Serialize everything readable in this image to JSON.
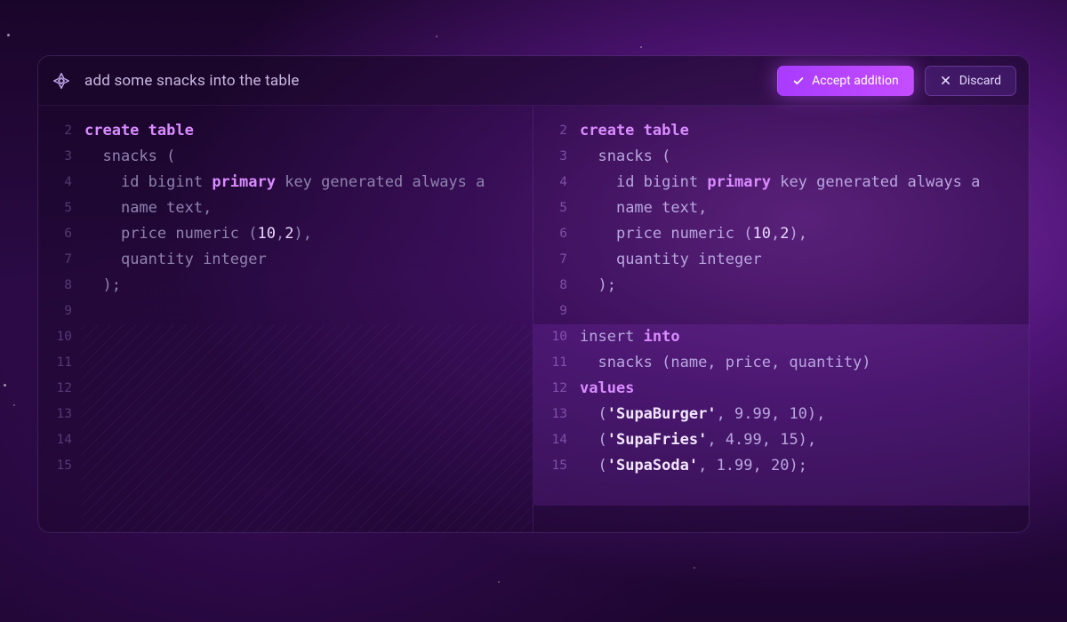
{
  "prompt": {
    "text": "add some snacks into the table",
    "accept_label": "Accept addition",
    "discard_label": "Discard"
  },
  "editor": {
    "line_numbers": [
      2,
      3,
      4,
      5,
      6,
      7,
      8,
      9,
      10,
      11,
      12,
      13,
      14,
      15
    ],
    "left": {
      "lines": [
        [
          [
            "kw",
            "create"
          ],
          [
            "sp",
            " "
          ],
          [
            "kw",
            "table"
          ]
        ],
        [
          [
            "ind",
            1
          ],
          [
            "base",
            "snacks ("
          ]
        ],
        [
          [
            "ind",
            2
          ],
          [
            "base",
            "id bigint "
          ],
          [
            "kw",
            "primary"
          ],
          [
            "base",
            " key generated always a"
          ]
        ],
        [
          [
            "ind",
            2
          ],
          [
            "base",
            "name text,"
          ]
        ],
        [
          [
            "ind",
            2
          ],
          [
            "base",
            "price numeric ("
          ],
          [
            "num",
            "10"
          ],
          [
            "base",
            ","
          ],
          [
            "num",
            "2"
          ],
          [
            "base",
            "),"
          ]
        ],
        [
          [
            "ind",
            2
          ],
          [
            "base",
            "quantity integer"
          ]
        ],
        [
          [
            "ind",
            1
          ],
          [
            "base",
            ");"
          ]
        ],
        [],
        [],
        [],
        [],
        [],
        [],
        []
      ]
    },
    "right": {
      "lines": [
        [
          [
            "kw",
            "create"
          ],
          [
            "sp",
            " "
          ],
          [
            "kw",
            "table"
          ]
        ],
        [
          [
            "ind",
            1
          ],
          [
            "base",
            "snacks ("
          ]
        ],
        [
          [
            "ind",
            2
          ],
          [
            "base",
            "id bigint "
          ],
          [
            "kw",
            "primary"
          ],
          [
            "base",
            " key generated always a"
          ]
        ],
        [
          [
            "ind",
            2
          ],
          [
            "base",
            "name text,"
          ]
        ],
        [
          [
            "ind",
            2
          ],
          [
            "base",
            "price numeric ("
          ],
          [
            "num",
            "10"
          ],
          [
            "base",
            ","
          ],
          [
            "num",
            "2"
          ],
          [
            "base",
            "),"
          ]
        ],
        [
          [
            "ind",
            2
          ],
          [
            "base",
            "quantity integer"
          ]
        ],
        [
          [
            "ind",
            1
          ],
          [
            "base",
            ");"
          ]
        ],
        [],
        [
          [
            "base",
            "insert "
          ],
          [
            "kw",
            "into"
          ]
        ],
        [
          [
            "ind",
            1
          ],
          [
            "base",
            "snacks (name, price, quantity)"
          ]
        ],
        [
          [
            "kw",
            "values"
          ]
        ],
        [
          [
            "ind",
            1
          ],
          [
            "base",
            "("
          ],
          [
            "str",
            "'SupaBurger'"
          ],
          [
            "base",
            ", 9.99, 10),"
          ]
        ],
        [
          [
            "ind",
            1
          ],
          [
            "base",
            "("
          ],
          [
            "str",
            "'SupaFries'"
          ],
          [
            "base",
            ", 4.99, 15),"
          ]
        ],
        [
          [
            "ind",
            1
          ],
          [
            "base",
            "("
          ],
          [
            "str",
            "'SupaSoda'"
          ],
          [
            "base",
            ", 1.99, 20);"
          ]
        ]
      ]
    }
  }
}
